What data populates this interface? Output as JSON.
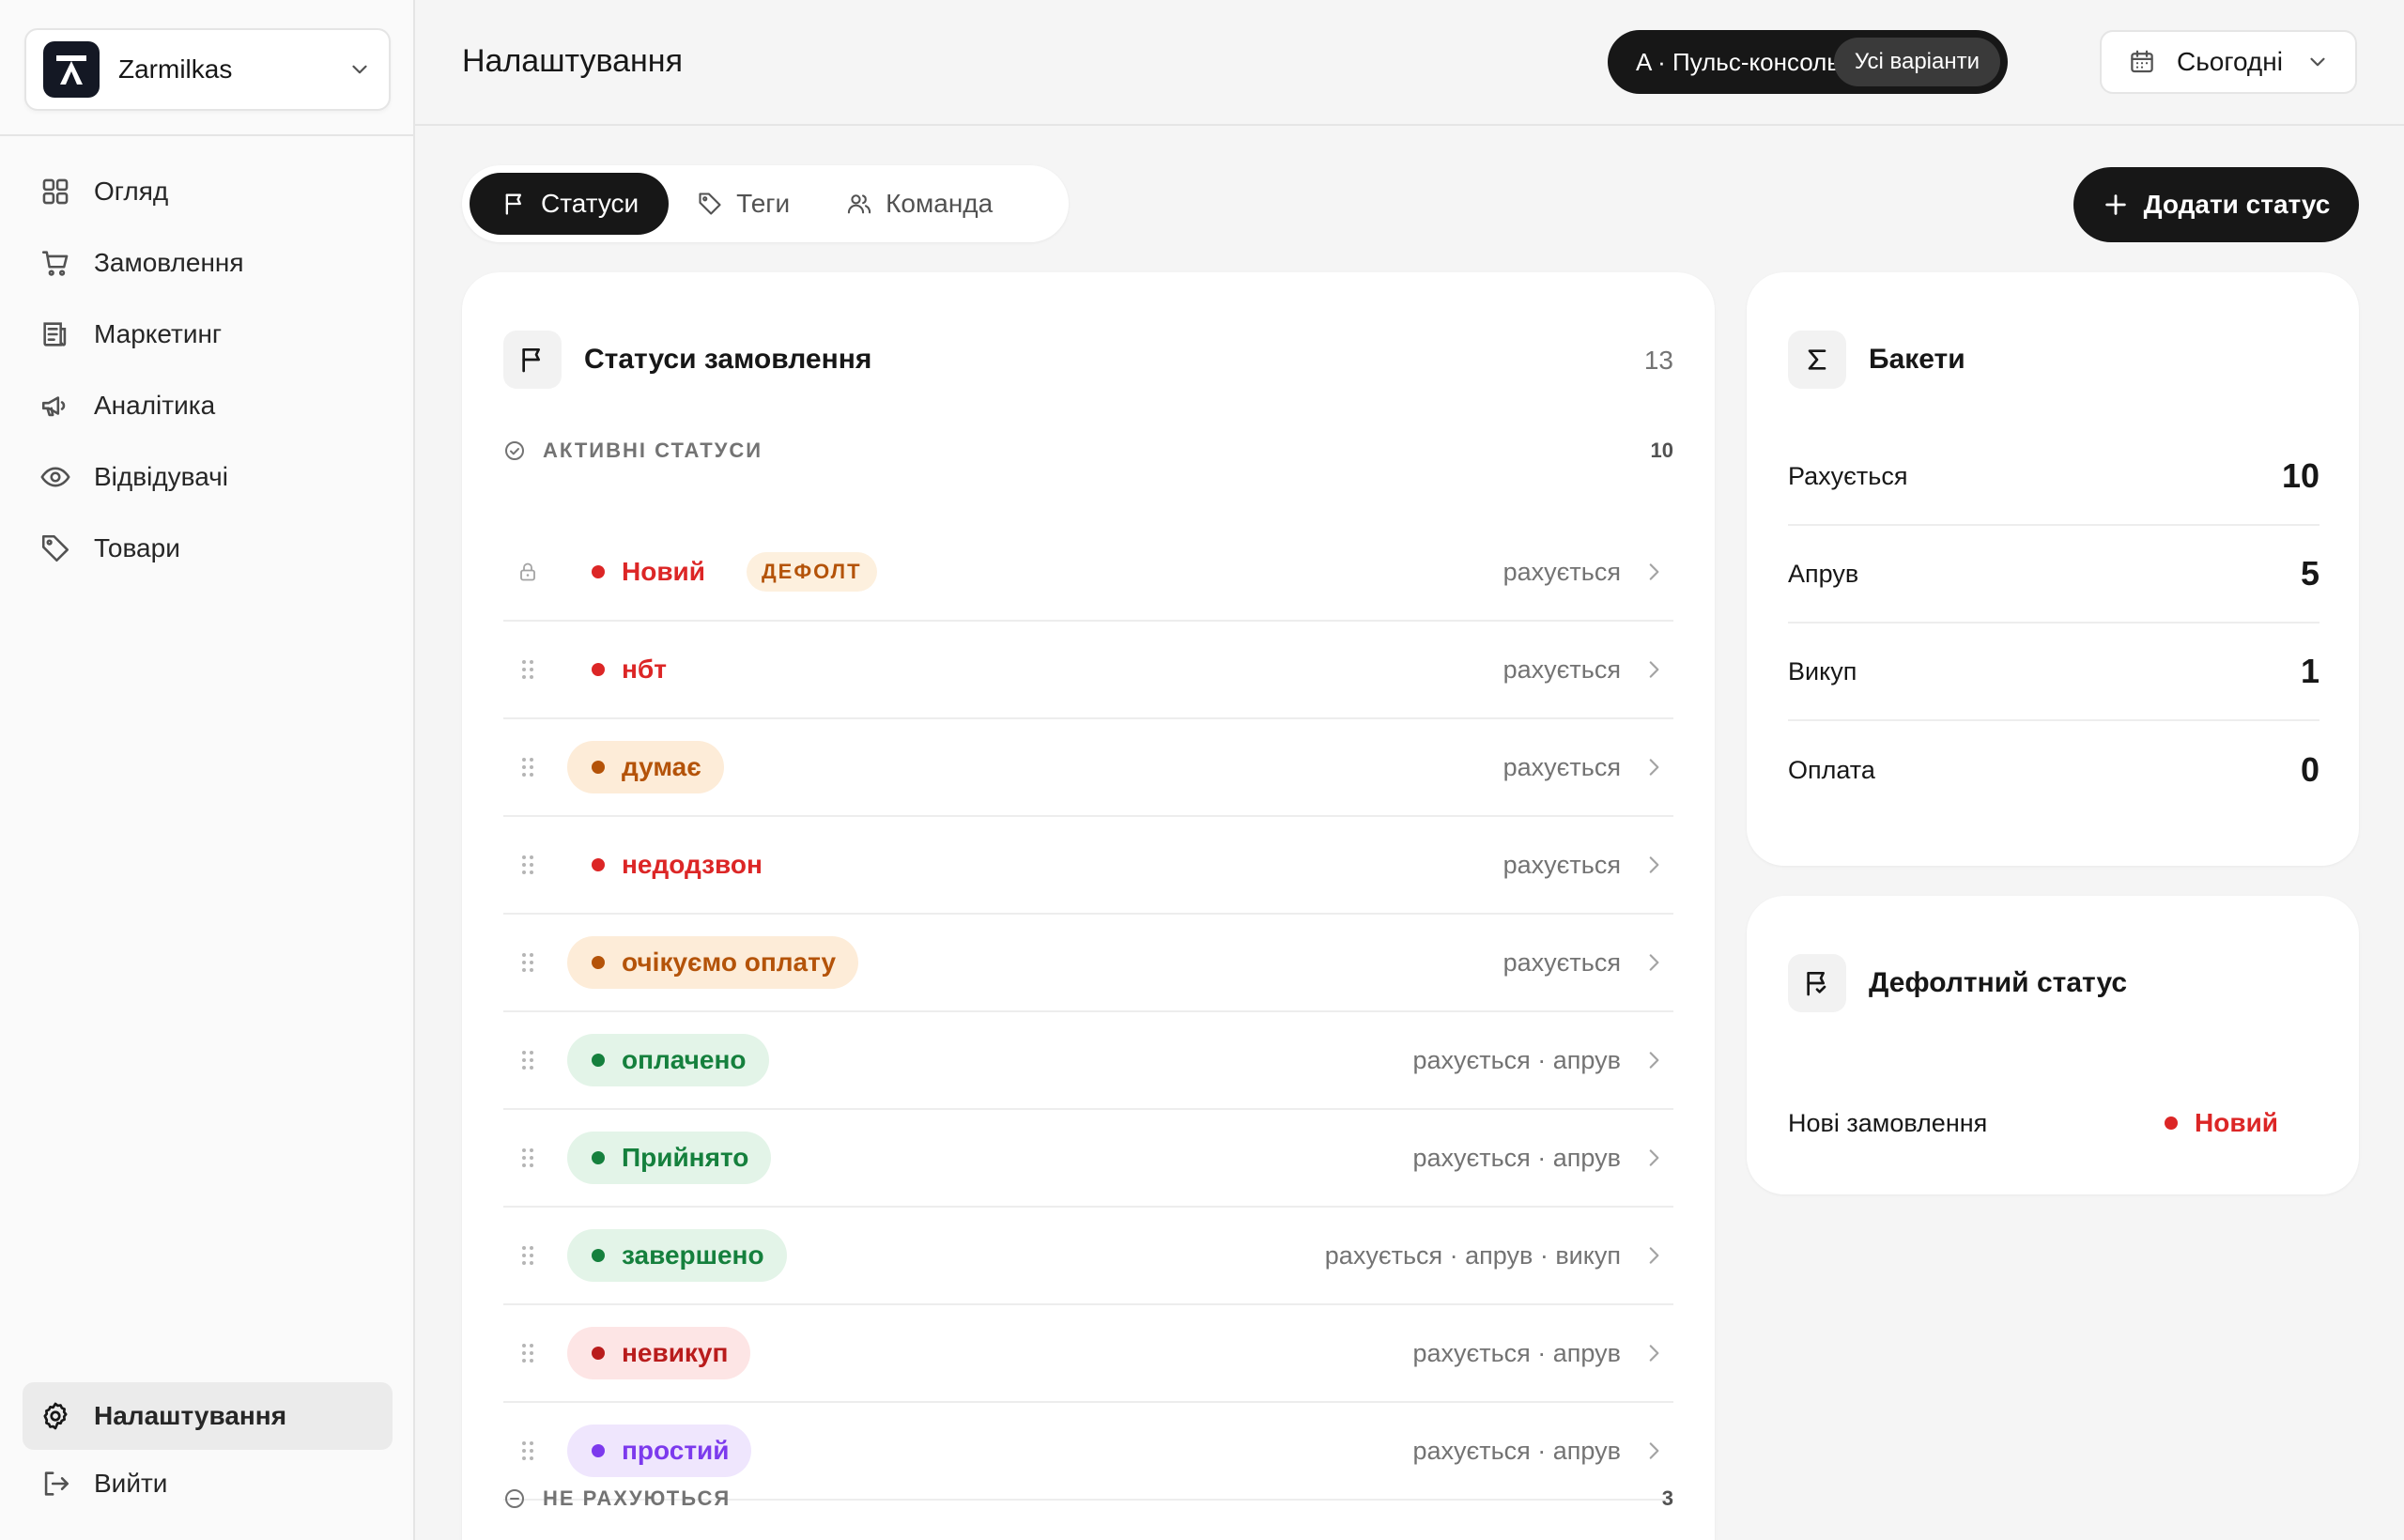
{
  "workspace": {
    "name": "Zarmilkas"
  },
  "nav": [
    {
      "label": "Огляд",
      "icon": "grid-icon"
    },
    {
      "label": "Замовлення",
      "icon": "cart-icon"
    },
    {
      "label": "Маркетинг",
      "icon": "newspaper-icon"
    },
    {
      "label": "Аналітика",
      "icon": "megaphone-icon"
    },
    {
      "label": "Відвідувачі",
      "icon": "eye-icon"
    },
    {
      "label": "Товари",
      "icon": "tag-icon"
    }
  ],
  "nav_bottom": {
    "settings": "Налаштування",
    "logout": "Вийти"
  },
  "header": {
    "title": "Налаштування",
    "variant": "A · Пульс-консоль",
    "variant_all": "Усі варіанти",
    "date": "Сьогодні"
  },
  "tabs": [
    {
      "label": "Статуси",
      "active": true
    },
    {
      "label": "Теги",
      "active": false
    },
    {
      "label": "Команда",
      "active": false
    }
  ],
  "add_button": "Додати статус",
  "statuses_card": {
    "title": "Статуси замовлення",
    "count": "13",
    "active_section": {
      "label": "АКТИВНІ СТАТУСИ",
      "count": "10"
    },
    "inactive_section": {
      "label": "НЕ РАХУЮТЬСЯ",
      "count": "3"
    },
    "default_badge": "ДЕФОЛТ",
    "rows": [
      {
        "name": "Новий",
        "flags": "рахується",
        "color": "#dc2626",
        "bg": "transparent",
        "locked": true,
        "default": true
      },
      {
        "name": "нбт",
        "flags": "рахується",
        "color": "#dc2626",
        "bg": "transparent"
      },
      {
        "name": "думає",
        "flags": "рахується",
        "color": "#b45309",
        "bg": "#fdecd8"
      },
      {
        "name": "недодзвон",
        "flags": "рахується",
        "color": "#dc2626",
        "bg": "transparent"
      },
      {
        "name": "очікуємо оплату",
        "flags": "рахується",
        "color": "#b45309",
        "bg": "#fdecd8"
      },
      {
        "name": "оплачено",
        "flags": "рахується · апрув",
        "color": "#15803d",
        "bg": "#e3f4e8"
      },
      {
        "name": "Прийнято",
        "flags": "рахується · апрув",
        "color": "#15803d",
        "bg": "#e3f4e8"
      },
      {
        "name": "завершено",
        "flags": "рахується · апрув · викуп",
        "color": "#15803d",
        "bg": "#e3f4e8"
      },
      {
        "name": "невикуп",
        "flags": "рахується · апрув",
        "color": "#b91c1c",
        "bg": "#fde5e5"
      },
      {
        "name": "простий",
        "flags": "рахується · апрув",
        "color": "#7c3aed",
        "bg": "#efe6fd"
      }
    ]
  },
  "buckets": {
    "title": "Бакети",
    "rows": [
      {
        "label": "Рахується",
        "value": "10"
      },
      {
        "label": "Апрув",
        "value": "5"
      },
      {
        "label": "Викуп",
        "value": "1"
      },
      {
        "label": "Оплата",
        "value": "0"
      }
    ]
  },
  "default_status": {
    "title": "Дефолтний статус",
    "label": "Нові замовлення",
    "value": "Новий",
    "color": "#dc2626"
  }
}
